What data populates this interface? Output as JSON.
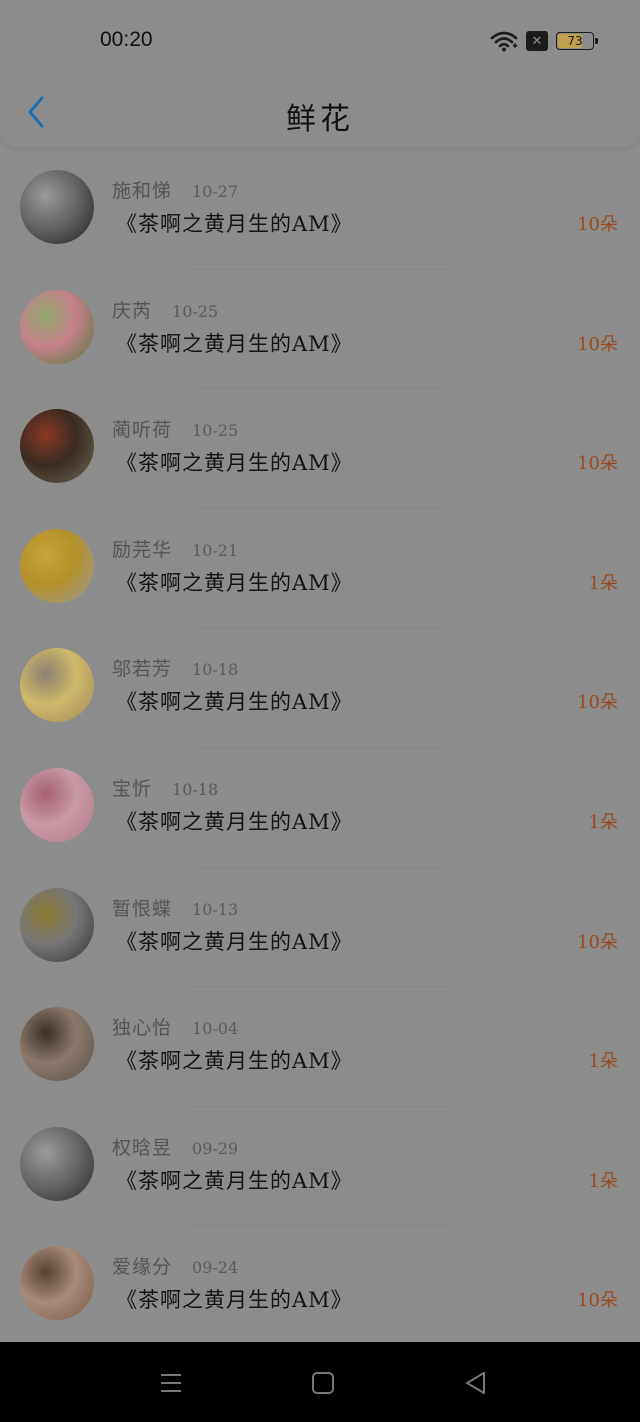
{
  "status_bar": {
    "time": "00:20",
    "battery": "73",
    "battery_level": 0.73,
    "sim_icon": "x-sim-icon",
    "wifi_icon": "wifi-icon"
  },
  "header": {
    "title": "鲜花",
    "back_icon": "chevron-left-icon",
    "accent_color": "#1f6fb0"
  },
  "colors": {
    "background": "#8c8c8c",
    "count_color": "#9a4a1c"
  },
  "items": [
    {
      "name": "施和悌",
      "date": "10-27",
      "title": "《茶啊之黄月生的AM》",
      "count": "10朵",
      "avatar_colors": [
        "#222",
        "#666",
        "#999"
      ]
    },
    {
      "name": "庆芮",
      "date": "10-25",
      "title": "《茶啊之黄月生的AM》",
      "count": "10朵",
      "avatar_colors": [
        "#4f7a3a",
        "#c57f8a",
        "#8fa86a"
      ]
    },
    {
      "name": "蔺听荷",
      "date": "10-25",
      "title": "《茶啊之黄月生的AM》",
      "count": "10朵",
      "avatar_colors": [
        "#6b6b55",
        "#3a2a22",
        "#8a3a22"
      ]
    },
    {
      "name": "励芫华",
      "date": "10-21",
      "title": "《茶啊之黄月生的AM》",
      "count": "1朵",
      "avatar_colors": [
        "#9a9a9a",
        "#b38f2a",
        "#c9a73a"
      ]
    },
    {
      "name": "邬若芳",
      "date": "10-18",
      "title": "《茶啊之黄月生的AM》",
      "count": "10朵",
      "avatar_colors": [
        "#a08a5a",
        "#d0b86a",
        "#8a8070"
      ]
    },
    {
      "name": "宝忻",
      "date": "10-18",
      "title": "《茶啊之黄月生的AM》",
      "count": "1朵",
      "avatar_colors": [
        "#b07a88",
        "#c99aa7",
        "#a46070"
      ]
    },
    {
      "name": "暂恨蝶",
      "date": "10-13",
      "title": "《茶啊之黄月生的AM》",
      "count": "10朵",
      "avatar_colors": [
        "#333",
        "#777",
        "#8a7a30"
      ]
    },
    {
      "name": "独心怡",
      "date": "10-04",
      "title": "《茶啊之黄月生的AM》",
      "count": "1朵",
      "avatar_colors": [
        "#5a5048",
        "#8a7a6a",
        "#3a3028"
      ]
    },
    {
      "name": "权晗昱",
      "date": "09-29",
      "title": "《茶啊之黄月生的AM》",
      "count": "1朵",
      "avatar_colors": [
        "#2a2a2a",
        "#6a6a6a",
        "#9a9a9a"
      ]
    },
    {
      "name": "爱缘分",
      "date": "09-24",
      "title": "《茶啊之黄月生的AM》",
      "count": "10朵",
      "avatar_colors": [
        "#7a5a48",
        "#a88a78",
        "#5a4034"
      ]
    }
  ],
  "nav_bar": {
    "menu_icon": "menu-icon",
    "home_icon": "square-home-icon",
    "back_icon": "triangle-back-icon"
  }
}
